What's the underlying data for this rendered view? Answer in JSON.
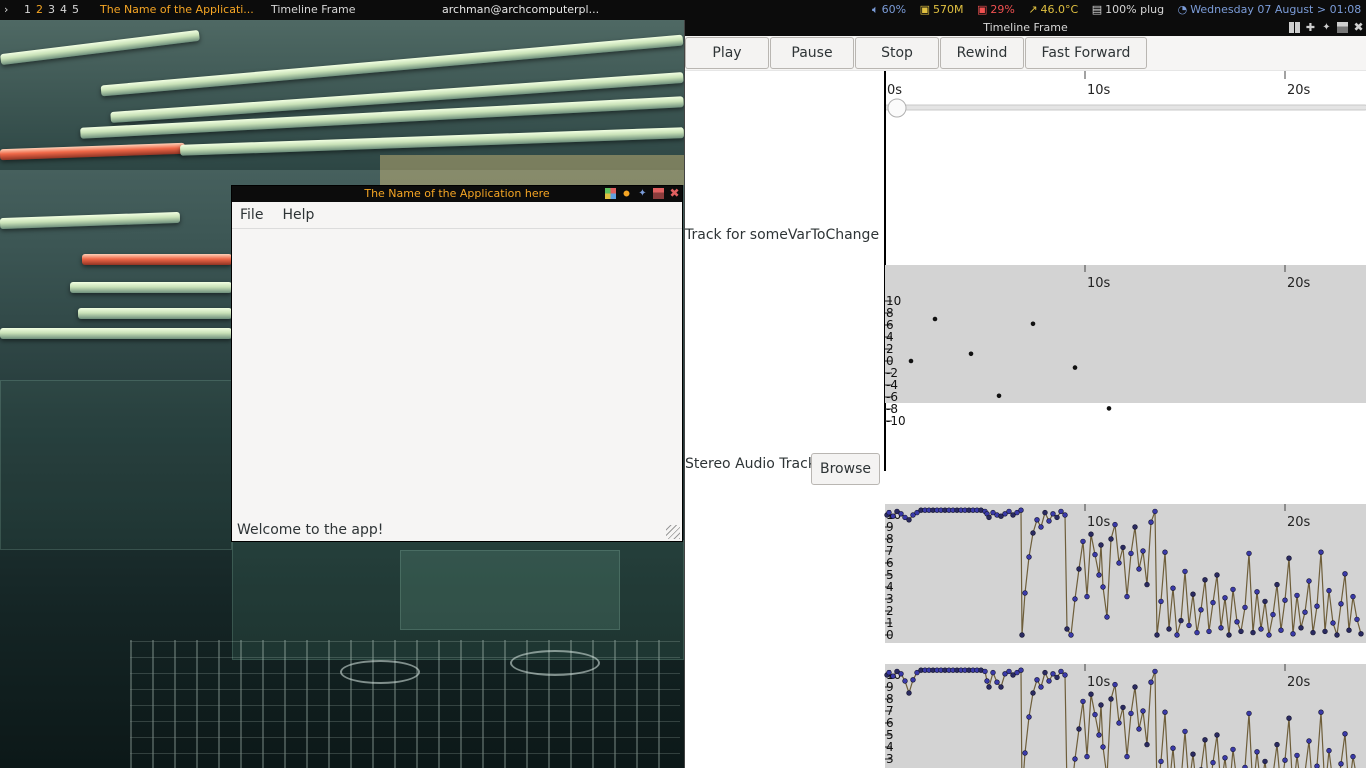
{
  "topbar": {
    "tags": [
      "1",
      "2",
      "3",
      "4",
      "5"
    ],
    "active_tag": "2",
    "focused_title": "The Name of the Applicati...",
    "second_title": "Timeline Frame",
    "user_host": "archman@archcomputerpl...",
    "volume": "60%",
    "memory": "570M",
    "cpu": "29%",
    "temperature": "46.0°C",
    "battery": "100% plug",
    "datetime": "Wednesday 07 August > 01:08",
    "colors": {
      "accent": "#f5a524",
      "status_blue": "#7b9cd8",
      "status_red": "#ef5050",
      "status_yellow": "#e0c040"
    }
  },
  "app_window": {
    "title": "The Name of the Application here",
    "menu": [
      "File",
      "Help"
    ],
    "status": "Welcome to the app!"
  },
  "timeline_window": {
    "title": "Timeline Frame",
    "buttons": [
      "Play",
      "Pause",
      "Stop",
      "Rewind",
      "Fast Forward"
    ],
    "track_label_1": "Track for someVarToChange",
    "track_label_2": "Stereo Audio Track",
    "browse_label": "Browse"
  },
  "chart_data": [
    {
      "type": "table",
      "ticks": [
        {
          "value": 0,
          "label": "0s"
        },
        {
          "value": 10,
          "label": "10s"
        },
        {
          "value": 20,
          "label": "20s"
        }
      ],
      "x_unit": "s",
      "playhead": 0
    },
    {
      "type": "scatter",
      "xlim": [
        0,
        24
      ],
      "ylim": [
        -10,
        10
      ],
      "y_ticks": [
        10,
        8,
        6,
        4,
        2,
        0,
        -2,
        -4,
        -6,
        -8,
        -10
      ],
      "x_ticks": [
        {
          "value": 10,
          "label": "10s"
        },
        {
          "value": 20,
          "label": "20s"
        }
      ],
      "points": [
        [
          1.3,
          0
        ],
        [
          2.5,
          7
        ],
        [
          4.3,
          1.2
        ],
        [
          5.7,
          -5.8
        ],
        [
          7.4,
          6.2
        ],
        [
          9.5,
          -1.1
        ],
        [
          11.2,
          -7.9
        ]
      ],
      "background": "#d3d3d3"
    },
    {
      "type": "line",
      "xlim": [
        0,
        24
      ],
      "ylim": [
        0,
        10
      ],
      "y_ticks": [
        10,
        9,
        8,
        7,
        6,
        5,
        4,
        3,
        2,
        1,
        0
      ],
      "x_ticks": [
        {
          "value": 10,
          "label": "10s"
        },
        {
          "value": 20,
          "label": "20s"
        }
      ],
      "background": "#d3d3d3",
      "series": [
        {
          "values": [
            [
              0.1,
              10.0
            ],
            [
              0.2,
              10.2
            ],
            [
              0.4,
              9.9
            ],
            [
              0.6,
              10.3
            ],
            [
              0.8,
              10.1
            ],
            [
              1.0,
              9.8
            ],
            [
              1.2,
              9.6
            ],
            [
              1.4,
              10.0
            ],
            [
              1.6,
              10.2
            ],
            [
              1.8,
              10.4
            ],
            [
              2.0,
              10.4
            ],
            [
              2.2,
              10.4
            ],
            [
              2.4,
              10.4
            ],
            [
              2.6,
              10.4
            ],
            [
              2.8,
              10.4
            ],
            [
              3.0,
              10.4
            ],
            [
              3.2,
              10.4
            ],
            [
              3.4,
              10.4
            ],
            [
              3.6,
              10.4
            ],
            [
              3.8,
              10.4
            ],
            [
              4.0,
              10.4
            ],
            [
              4.2,
              10.4
            ],
            [
              4.4,
              10.4
            ],
            [
              4.6,
              10.4
            ],
            [
              4.8,
              10.4
            ],
            [
              5.0,
              10.3
            ],
            [
              5.1,
              10.1
            ],
            [
              5.2,
              9.8
            ],
            [
              5.4,
              10.2
            ],
            [
              5.6,
              10.0
            ],
            [
              5.8,
              9.9
            ],
            [
              6.0,
              10.1
            ],
            [
              6.2,
              10.3
            ],
            [
              6.4,
              10.0
            ],
            [
              6.6,
              10.2
            ],
            [
              6.8,
              10.4
            ],
            [
              6.85,
              0.0
            ],
            [
              7.0,
              3.5
            ],
            [
              7.2,
              6.5
            ],
            [
              7.4,
              8.5
            ],
            [
              7.6,
              9.6
            ],
            [
              7.8,
              9.0
            ],
            [
              8.0,
              10.2
            ],
            [
              8.2,
              9.5
            ],
            [
              8.4,
              10.1
            ],
            [
              8.6,
              9.8
            ],
            [
              8.8,
              10.3
            ],
            [
              9.0,
              10.0
            ],
            [
              9.1,
              0.5
            ],
            [
              9.3,
              0.0
            ],
            [
              9.5,
              3.0
            ],
            [
              9.7,
              5.5
            ],
            [
              9.9,
              7.8
            ],
            [
              10.1,
              3.2
            ],
            [
              10.3,
              8.4
            ],
            [
              10.5,
              6.7
            ],
            [
              10.7,
              5.0
            ],
            [
              10.8,
              7.5
            ],
            [
              10.9,
              4.0
            ],
            [
              11.1,
              1.5
            ],
            [
              11.3,
              8.0
            ],
            [
              11.5,
              9.2
            ],
            [
              11.7,
              6.0
            ],
            [
              11.9,
              7.3
            ],
            [
              12.1,
              3.2
            ],
            [
              12.3,
              6.8
            ],
            [
              12.5,
              9.0
            ],
            [
              12.7,
              5.5
            ],
            [
              12.9,
              7.0
            ],
            [
              13.1,
              4.2
            ],
            [
              13.3,
              9.4
            ],
            [
              13.5,
              10.3
            ],
            [
              13.6,
              0.0
            ],
            [
              13.8,
              2.8
            ],
            [
              14.0,
              6.9
            ],
            [
              14.2,
              0.5
            ],
            [
              14.4,
              3.9
            ],
            [
              14.6,
              0.0
            ],
            [
              14.8,
              1.2
            ],
            [
              15.0,
              5.3
            ],
            [
              15.2,
              0.8
            ],
            [
              15.4,
              3.4
            ],
            [
              15.6,
              0.2
            ],
            [
              15.8,
              2.1
            ],
            [
              16.0,
              4.6
            ],
            [
              16.2,
              0.3
            ],
            [
              16.4,
              2.7
            ],
            [
              16.6,
              5.0
            ],
            [
              16.8,
              0.6
            ],
            [
              17.0,
              3.1
            ],
            [
              17.2,
              0.0
            ],
            [
              17.4,
              3.8
            ],
            [
              17.6,
              1.1
            ],
            [
              17.8,
              0.3
            ],
            [
              18.0,
              2.3
            ],
            [
              18.2,
              6.8
            ],
            [
              18.4,
              0.2
            ],
            [
              18.6,
              3.6
            ],
            [
              18.8,
              0.5
            ],
            [
              19.0,
              2.8
            ],
            [
              19.2,
              0.0
            ],
            [
              19.4,
              1.7
            ],
            [
              19.6,
              4.2
            ],
            [
              19.8,
              0.4
            ],
            [
              20.0,
              2.9
            ],
            [
              20.2,
              6.4
            ],
            [
              20.4,
              0.1
            ],
            [
              20.6,
              3.3
            ],
            [
              20.8,
              0.6
            ],
            [
              21.0,
              1.9
            ],
            [
              21.2,
              4.5
            ],
            [
              21.4,
              0.2
            ],
            [
              21.6,
              2.4
            ],
            [
              21.8,
              6.9
            ],
            [
              22.0,
              0.3
            ],
            [
              22.2,
              3.7
            ],
            [
              22.4,
              1.0
            ],
            [
              22.6,
              0.0
            ],
            [
              22.8,
              2.6
            ],
            [
              23.0,
              5.1
            ],
            [
              23.2,
              0.4
            ],
            [
              23.4,
              3.2
            ],
            [
              23.6,
              1.3
            ],
            [
              23.8,
              0.1
            ]
          ]
        }
      ]
    },
    {
      "type": "line",
      "xlim": [
        0,
        24
      ],
      "ylim": [
        0,
        10
      ],
      "y_ticks": [
        10,
        9,
        8,
        7,
        6,
        5,
        4,
        3
      ],
      "x_ticks": [
        {
          "value": 10,
          "label": "10s"
        },
        {
          "value": 20,
          "label": "20s"
        }
      ],
      "background": "#d3d3d3",
      "series": [
        {
          "values": [
            [
              0.1,
              10.0
            ],
            [
              0.2,
              10.2
            ],
            [
              0.4,
              9.9
            ],
            [
              0.6,
              10.3
            ],
            [
              0.8,
              10.1
            ],
            [
              1.0,
              9.5
            ],
            [
              1.2,
              8.5
            ],
            [
              1.4,
              9.6
            ],
            [
              1.6,
              10.2
            ],
            [
              1.8,
              10.4
            ],
            [
              2.0,
              10.4
            ],
            [
              2.2,
              10.4
            ],
            [
              2.4,
              10.4
            ],
            [
              2.6,
              10.4
            ],
            [
              2.8,
              10.4
            ],
            [
              3.0,
              10.4
            ],
            [
              3.2,
              10.4
            ],
            [
              3.4,
              10.4
            ],
            [
              3.6,
              10.4
            ],
            [
              3.8,
              10.4
            ],
            [
              4.0,
              10.4
            ],
            [
              4.2,
              10.4
            ],
            [
              4.4,
              10.4
            ],
            [
              4.6,
              10.4
            ],
            [
              4.8,
              10.4
            ],
            [
              5.0,
              10.3
            ],
            [
              5.1,
              9.5
            ],
            [
              5.2,
              9.0
            ],
            [
              5.4,
              10.2
            ],
            [
              5.6,
              9.4
            ],
            [
              5.8,
              9.0
            ],
            [
              6.0,
              10.1
            ],
            [
              6.2,
              10.3
            ],
            [
              6.4,
              10.0
            ],
            [
              6.6,
              10.2
            ],
            [
              6.8,
              10.4
            ],
            [
              6.85,
              0.0
            ],
            [
              7.0,
              3.5
            ],
            [
              7.2,
              6.5
            ],
            [
              7.4,
              8.5
            ],
            [
              7.6,
              9.6
            ],
            [
              7.8,
              9.0
            ],
            [
              8.0,
              10.2
            ],
            [
              8.2,
              9.5
            ],
            [
              8.4,
              10.1
            ],
            [
              8.6,
              9.8
            ],
            [
              8.8,
              10.3
            ],
            [
              9.0,
              10.0
            ],
            [
              9.1,
              0.5
            ],
            [
              9.3,
              0.0
            ],
            [
              9.5,
              3.0
            ],
            [
              9.7,
              5.5
            ],
            [
              9.9,
              7.8
            ],
            [
              10.1,
              3.2
            ],
            [
              10.3,
              8.4
            ],
            [
              10.5,
              6.7
            ],
            [
              10.7,
              5.0
            ],
            [
              10.8,
              7.5
            ],
            [
              10.9,
              4.0
            ],
            [
              11.1,
              1.5
            ],
            [
              11.3,
              8.0
            ],
            [
              11.5,
              9.2
            ],
            [
              11.7,
              6.0
            ],
            [
              11.9,
              7.3
            ],
            [
              12.1,
              3.2
            ],
            [
              12.3,
              6.8
            ],
            [
              12.5,
              9.0
            ],
            [
              12.7,
              5.5
            ],
            [
              12.9,
              7.0
            ],
            [
              13.1,
              4.2
            ],
            [
              13.3,
              9.4
            ],
            [
              13.5,
              10.3
            ],
            [
              13.6,
              0.0
            ],
            [
              13.8,
              2.8
            ],
            [
              14.0,
              6.9
            ],
            [
              14.2,
              0.5
            ],
            [
              14.4,
              3.9
            ],
            [
              14.6,
              0.0
            ],
            [
              14.8,
              1.2
            ],
            [
              15.0,
              5.3
            ],
            [
              15.2,
              0.8
            ],
            [
              15.4,
              3.4
            ],
            [
              15.6,
              0.2
            ],
            [
              15.8,
              2.1
            ],
            [
              16.0,
              4.6
            ],
            [
              16.2,
              0.3
            ],
            [
              16.4,
              2.7
            ],
            [
              16.6,
              5.0
            ],
            [
              16.8,
              0.6
            ],
            [
              17.0,
              3.1
            ],
            [
              17.2,
              0.0
            ],
            [
              17.4,
              3.8
            ],
            [
              17.6,
              1.1
            ],
            [
              17.8,
              0.3
            ],
            [
              18.0,
              2.3
            ],
            [
              18.2,
              6.8
            ],
            [
              18.4,
              0.2
            ],
            [
              18.6,
              3.6
            ],
            [
              18.8,
              0.5
            ],
            [
              19.0,
              2.8
            ],
            [
              19.2,
              0.0
            ],
            [
              19.4,
              1.7
            ],
            [
              19.6,
              4.2
            ],
            [
              19.8,
              0.4
            ],
            [
              20.0,
              2.9
            ],
            [
              20.2,
              6.4
            ],
            [
              20.4,
              0.1
            ],
            [
              20.6,
              3.3
            ],
            [
              20.8,
              0.6
            ],
            [
              21.0,
              1.9
            ],
            [
              21.2,
              4.5
            ],
            [
              21.4,
              0.2
            ],
            [
              21.6,
              2.4
            ],
            [
              21.8,
              6.9
            ],
            [
              22.0,
              0.3
            ],
            [
              22.2,
              3.7
            ],
            [
              22.4,
              1.0
            ],
            [
              22.6,
              0.0
            ],
            [
              22.8,
              2.6
            ],
            [
              23.0,
              5.1
            ],
            [
              23.2,
              0.4
            ],
            [
              23.4,
              3.2
            ],
            [
              23.6,
              1.3
            ],
            [
              23.8,
              0.1
            ]
          ]
        }
      ]
    }
  ]
}
